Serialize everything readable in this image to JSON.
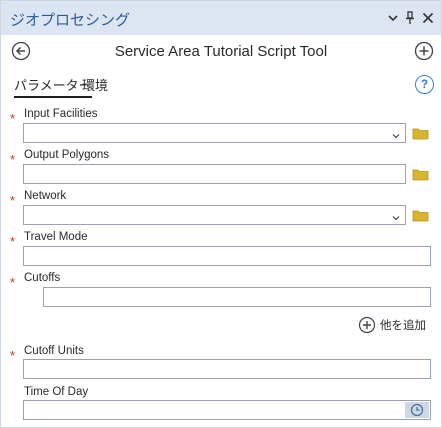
{
  "pane": {
    "title": "ジオプロセシング"
  },
  "tool": {
    "title": "Service Area Tutorial Script Tool"
  },
  "tabs": [
    {
      "label": "パラメーター",
      "active": true
    },
    {
      "label": "環境",
      "active": false
    }
  ],
  "help": {
    "glyph": "?"
  },
  "required_marker": "*",
  "params": {
    "input_facilities": {
      "label": "Input Facilities",
      "required": true,
      "value": ""
    },
    "output_polygons": {
      "label": "Output Polygons",
      "required": true,
      "value": ""
    },
    "network": {
      "label": "Network",
      "required": true,
      "value": ""
    },
    "travel_mode": {
      "label": "Travel Mode",
      "required": true,
      "value": ""
    },
    "cutoffs": {
      "label": "Cutoffs",
      "required": true,
      "value": ""
    },
    "cutoff_units": {
      "label": "Cutoff Units",
      "required": true,
      "value": ""
    },
    "time_of_day": {
      "label": "Time Of Day",
      "required": false,
      "value": ""
    }
  },
  "add_other": {
    "label": "他を追加"
  },
  "icons": {
    "back": "back-arrow-icon",
    "add": "add-circle-icon",
    "folder": "folder-icon",
    "clock": "clock-icon",
    "chevron": "chevron-down-icon",
    "pin": "pin-icon",
    "close": "close-icon"
  },
  "colors": {
    "titlebar": "#dce6f2",
    "title_text": "#2b5d9a",
    "required": "#c0392b",
    "folder": "#d9b52e",
    "link_blue": "#3a7fd4"
  }
}
